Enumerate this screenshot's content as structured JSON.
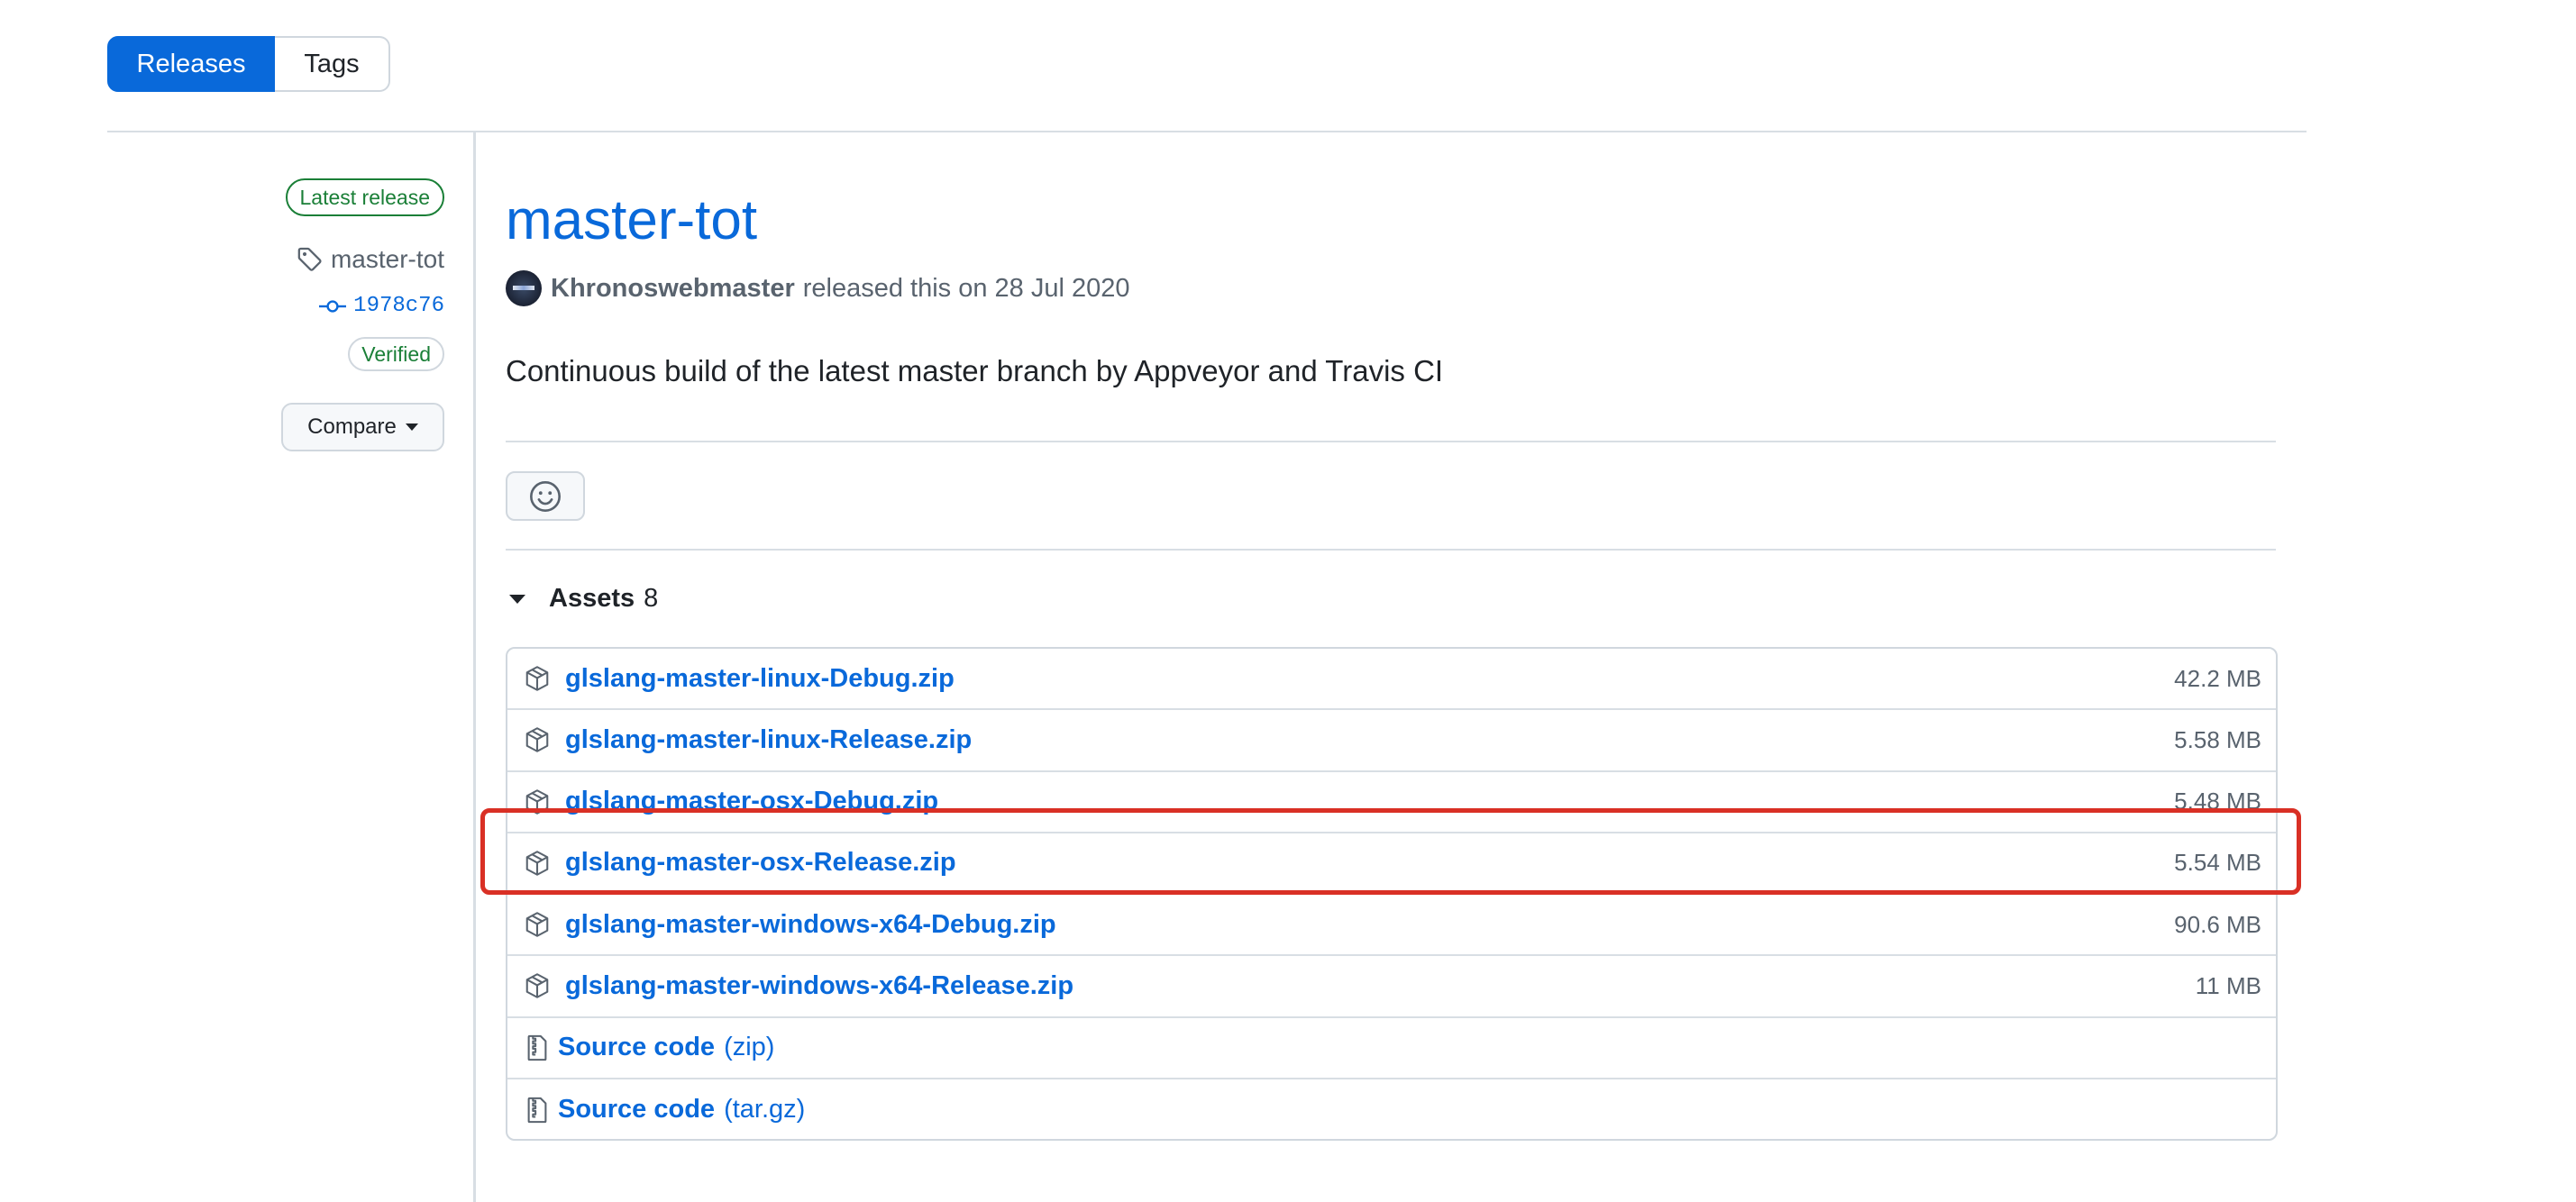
{
  "subnav": {
    "releases": "Releases",
    "tags": "Tags"
  },
  "sidebar": {
    "latest_badge": "Latest release",
    "tag": "master-tot",
    "commit": "1978c76",
    "verified": "Verified",
    "compare": "Compare"
  },
  "release": {
    "title": "master-tot",
    "author": "Khronoswebmaster",
    "released_text": "released this on 28 Jul 2020",
    "description": "Continuous build of the latest master branch by Appveyor and Travis CI"
  },
  "assets": {
    "label": "Assets",
    "count": "8",
    "items": [
      {
        "name": "glslang-master-linux-Debug.zip",
        "size": "42.2 MB"
      },
      {
        "name": "glslang-master-linux-Release.zip",
        "size": "5.58 MB"
      },
      {
        "name": "glslang-master-osx-Debug.zip",
        "size": "5.48 MB"
      },
      {
        "name": "glslang-master-osx-Release.zip",
        "size": "5.54 MB"
      },
      {
        "name": "glslang-master-windows-x64-Debug.zip",
        "size": "90.6 MB"
      },
      {
        "name": "glslang-master-windows-x64-Release.zip",
        "size": "11 MB"
      }
    ],
    "sources": [
      {
        "name": "Source code",
        "ext": "(zip)"
      },
      {
        "name": "Source code",
        "ext": "(tar.gz)"
      }
    ]
  },
  "colors": {
    "accent": "#0969da",
    "success": "#1a7f37",
    "highlight": "#d93025"
  }
}
